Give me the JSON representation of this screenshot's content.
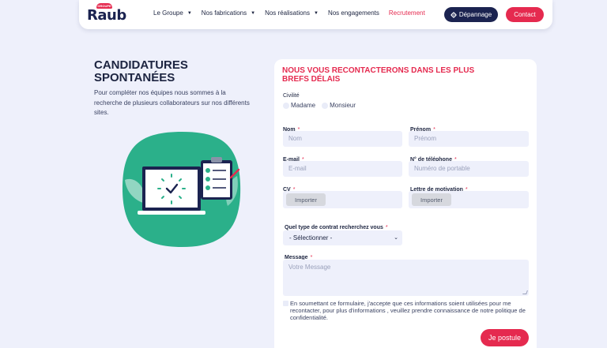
{
  "header": {
    "logo_text": "Raub",
    "logo_badge": "GROUPE",
    "nav": [
      {
        "label": "Le Groupe",
        "has_caret": true
      },
      {
        "label": "Nos fabrications",
        "has_caret": true
      },
      {
        "label": "Nos réalisations",
        "has_caret": true
      },
      {
        "label": "Nos engagements",
        "has_caret": false
      },
      {
        "label": "Recrutement",
        "has_caret": false
      }
    ],
    "depannage_label": "Dépannage",
    "contact_label": "Contact"
  },
  "page": {
    "title": "CANDIDATURES SPONTANÉES",
    "intro": "Pour compléter nos équipes nous sommes à la recherche de plusieurs collaborateurs sur nos différents sites."
  },
  "form": {
    "heading": "NOUS VOUS RECONTACTERONS DANS LES PLUS BREFS DÉLAIS",
    "civilite_label": "Civilité",
    "civilite_options": [
      "Madame",
      "Monsieur"
    ],
    "nom_label": "Nom",
    "nom_placeholder": "Nom",
    "prenom_label": "Prénom",
    "prenom_placeholder": "Prénom",
    "email_label": "E-mail",
    "email_placeholder": "E-mail",
    "telephone_label": "N° de téléphone",
    "telephone_placeholder": "Numéro de portable",
    "cv_label": "CV",
    "motivation_label": "Lettre de motivation",
    "import_label": "Importer",
    "contrat_label": "Quel type de contrat recherchez vous",
    "contrat_selected": "- Sélectionner -",
    "message_label": "Message",
    "message_placeholder": "Votre Message",
    "required_mark": "*",
    "consent_text": "En soumettant ce formulaire, j'accepte que ces informations soient utilisées pour me recontacter, pour plus d'informations , veuillez prendre connaissance de notre politique de confidentialité.",
    "submit_label": "Je postule"
  },
  "colors": {
    "accent": "#e52a4f",
    "navy": "#1b2350",
    "background": "#eef0fb",
    "illustration_green": "#2bb08a"
  }
}
